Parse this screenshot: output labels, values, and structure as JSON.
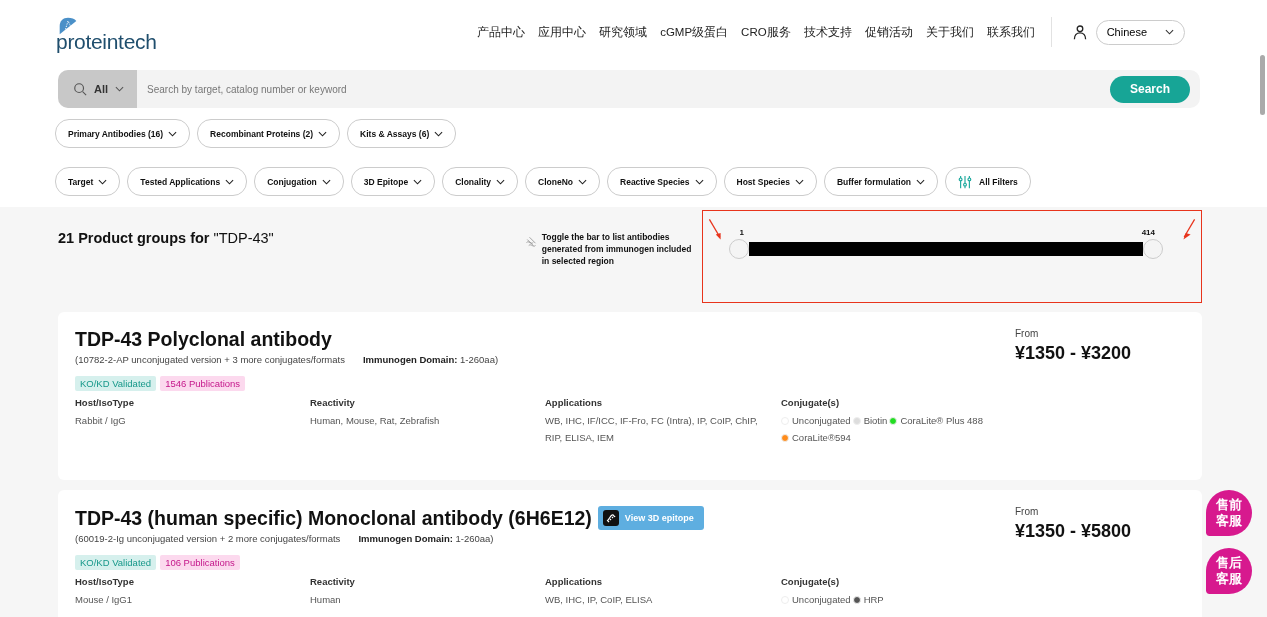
{
  "logo": {
    "text": "proteintech"
  },
  "nav": [
    "产品中心",
    "应用中心",
    "研究领域",
    "cGMP级蛋白",
    "CRO服务",
    "技术支持",
    "促销活动",
    "关于我们",
    "联系我们"
  ],
  "language": "Chinese",
  "search": {
    "scope": "All",
    "placeholder": "Search by target, catalog number or keyword",
    "button": "Search"
  },
  "categories": [
    "Primary Antibodies (16)",
    "Recombinant Proteins (2)",
    "Kits & Assays (6)"
  ],
  "filters": [
    "Target",
    "Tested Applications",
    "Conjugation",
    "3D Epitope",
    "Clonality",
    "CloneNo",
    "Reactive Species",
    "Host Species",
    "Buffer formulation"
  ],
  "all_filters": "All Filters",
  "results_title": "**21 Product groups for** \"TDP-43\"",
  "range_hint": "Toggle the bar to list antibodies generated from immunogen included in selected region",
  "range": {
    "min_label": "1",
    "max_label": "414",
    "level": 1
  },
  "products": [
    {
      "title": "TDP-43 Polyclonal antibody",
      "subtitle": "(10782-2-AP unconjugated version + 3 more conjugates/formats",
      "domain": "**Immunogen Domain:** 1-260aa)",
      "badges": [
        {
          "text": "KO/KD Validated",
          "kind": "validated"
        },
        {
          "text": "1546 Publications",
          "kind": "publications"
        }
      ],
      "specs": [
        {
          "label": "Host/IsoType",
          "value": "Rabbit / IgG"
        },
        {
          "label": "Reactivity",
          "value": "Human, Mouse, Rat, Zebrafish"
        },
        {
          "label": "Applications",
          "value": "WB, IHC, IF/ICC, IF-Fro, FC (Intra), IP, CoIP, ChIP, RIP, ELISA, IEM"
        }
      ],
      "conjugate_label": "Conjugate(s)",
      "conjugates": [
        {
          "name": "Unconjugated",
          "color": "#ffffff"
        },
        {
          "name": "Biotin",
          "color": "#dddddd"
        },
        {
          "name": "CoraLite® Plus 488",
          "color": "#22dd22"
        },
        {
          "name": "CoraLite®594",
          "color": "#ff8c1a"
        }
      ],
      "price_label": "From",
      "price": "¥1350 - ¥3200"
    },
    {
      "title": "TDP-43 (human specific) Monoclonal antibody (6H6E12)",
      "epitope_button": "View 3D epitope",
      "subtitle": "(60019-2-Ig unconjugated version + 2 more conjugates/formats",
      "domain": "**Immunogen Domain:** 1-260aa)",
      "badges": [
        {
          "text": "KO/KD Validated",
          "kind": "validated"
        },
        {
          "text": "106 Publications",
          "kind": "publications"
        }
      ],
      "specs": [
        {
          "label": "Host/IsoType",
          "value": "Mouse / IgG1"
        },
        {
          "label": "Reactivity",
          "value": "Human"
        },
        {
          "label": "Applications",
          "value": "WB, IHC, IP, CoIP, ELISA"
        }
      ],
      "conjugate_label": "Conjugate(s)",
      "conjugates": [
        {
          "name": "Unconjugated",
          "color": "#ffffff"
        },
        {
          "name": "HRP",
          "color": "#555555"
        }
      ],
      "price_label": "From",
      "price": "¥1350 - ¥5800"
    }
  ],
  "chat": [
    "售前客服",
    "售后客服"
  ]
}
